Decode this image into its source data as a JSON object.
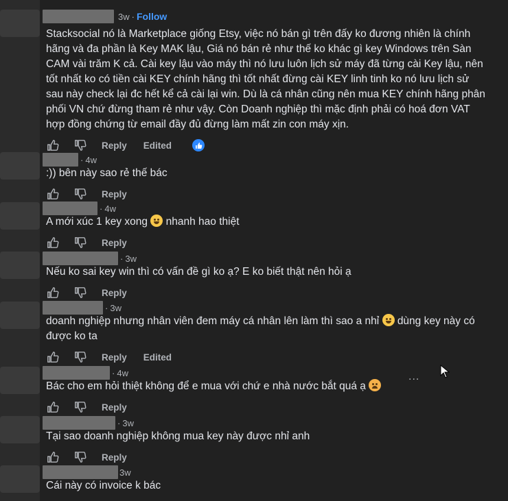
{
  "comments": [
    {
      "time": "3w",
      "follow": "Follow",
      "text": "Stacksocial nó là Marketplace giống Etsy, việc nó bán gì trên đấy ko đương nhiên là chính hãng và đa phần là Key MAK lậu, Giá nó bán rẻ như thế ko khác gì key Windows trên Sàn CAM vài trăm K cả. Cài key lậu vào máy thì nó lưu luôn lịch sử máy đã từng cài Key lậu, nên tốt nhất ko có tiền cài KEY chính hãng thì tốt nhất đừng cài KEY linh tinh ko nó lưu lịch sử sau này check lại đc hết kể cả cài lại win. Dù là cá nhân cũng nên mua KEY chính hãng phân phối VN chứ đừng tham rẻ như vậy. Còn Doanh nghiệp thì mặc định phải có hoá đơn VAT hợp đồng chứng từ email đầy đủ đừng làm mất zin con máy xịn.",
      "reply": "Reply",
      "edited": "Edited"
    },
    {
      "time": "4w",
      "text": ":)) bên này sao rẻ thế bác",
      "reply": "Reply"
    },
    {
      "time": "4w",
      "text": "A mới xúc 1 key xong",
      "text_after": "nhanh hao thiệt",
      "reply": "Reply"
    },
    {
      "time": "3w",
      "text": "Nếu ko sai key win thì có vấn đề gì ko ạ? E ko biết thật nên hỏi ạ",
      "reply": "Reply"
    },
    {
      "time": "3w",
      "text": "doanh nghiệp nhưng nhân viên đem máy cá nhân lên làm thì sao a nhỉ",
      "text_after": "dùng key này có được ko ta",
      "reply": "Reply",
      "edited": "Edited"
    },
    {
      "time": "4w",
      "text": "Bác cho em hỏi thiệt không để e mua với chứ e nhà nước bắt quá ạ",
      "reply": "Reply"
    },
    {
      "time": "3w",
      "text": "Tại sao doanh nghiệp không mua key này được nhỉ anh",
      "reply": "Reply"
    },
    {
      "time": "3w",
      "text": "Cái này có invoice k bác"
    }
  ],
  "more_menu": "...",
  "colors": {
    "background": "#212121",
    "text": "#e4e6eb",
    "muted": "#b0b3b8",
    "link": "#4599ff"
  }
}
